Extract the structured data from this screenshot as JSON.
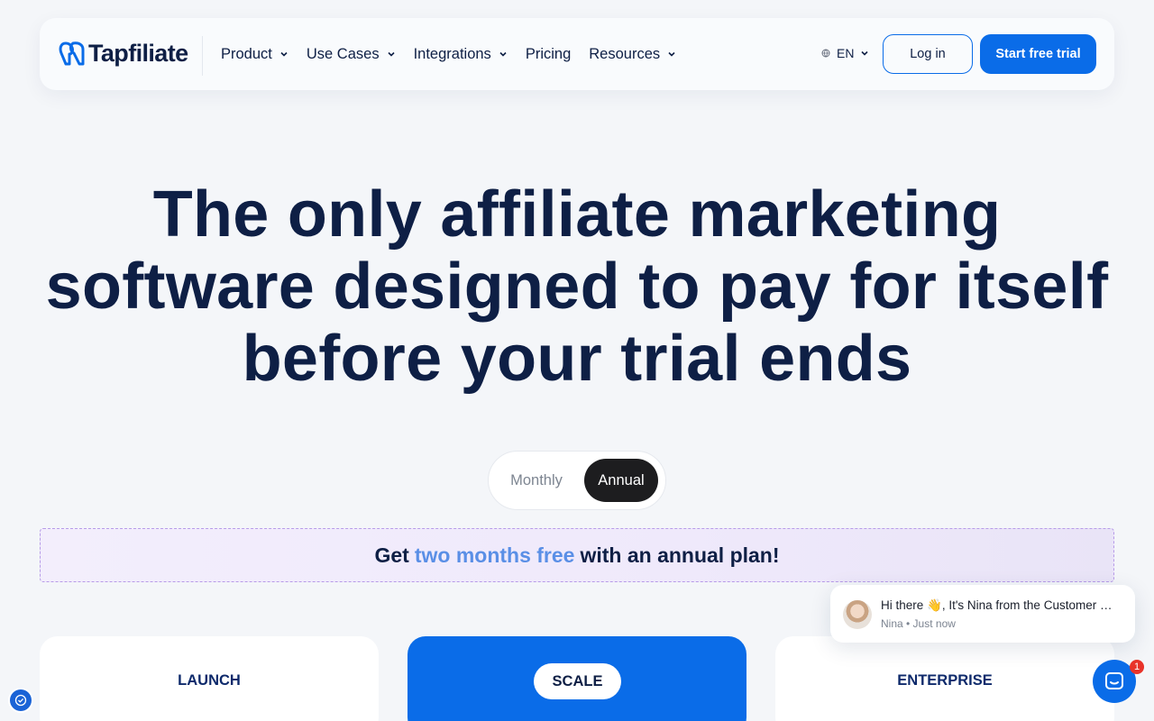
{
  "nav": {
    "logo_text": "Tapfiliate",
    "menu": [
      {
        "label": "Product",
        "has_dropdown": true
      },
      {
        "label": "Use Cases",
        "has_dropdown": true
      },
      {
        "label": "Integrations",
        "has_dropdown": true
      },
      {
        "label": "Pricing",
        "has_dropdown": false
      },
      {
        "label": "Resources",
        "has_dropdown": true
      }
    ],
    "language": "EN",
    "login_label": "Log in",
    "cta_label": "Start free trial"
  },
  "hero": {
    "lines": [
      "The only affiliate marketing",
      "software designed to pay for itself",
      "before your trial ends"
    ]
  },
  "billing": {
    "monthly_label": "Monthly",
    "annual_label": "Annual",
    "selected": "Annual"
  },
  "promo": {
    "prefix": "Get",
    "accent": "two months free",
    "suffix": "with an annual plan!"
  },
  "plans": [
    {
      "name": "LAUNCH"
    },
    {
      "name": "SCALE"
    },
    {
      "name": "ENTERPRISE"
    }
  ],
  "chat": {
    "message": "Hi there 👋, It's Nina from the Customer Success team",
    "meta": "Nina • Just now",
    "unread_count": "1"
  },
  "colors": {
    "brand_blue": "#0a6ce8",
    "navy_text": "#0e1f45",
    "accent_blue": "#5a8fe6",
    "toggle_dark": "#1d1d1f"
  }
}
